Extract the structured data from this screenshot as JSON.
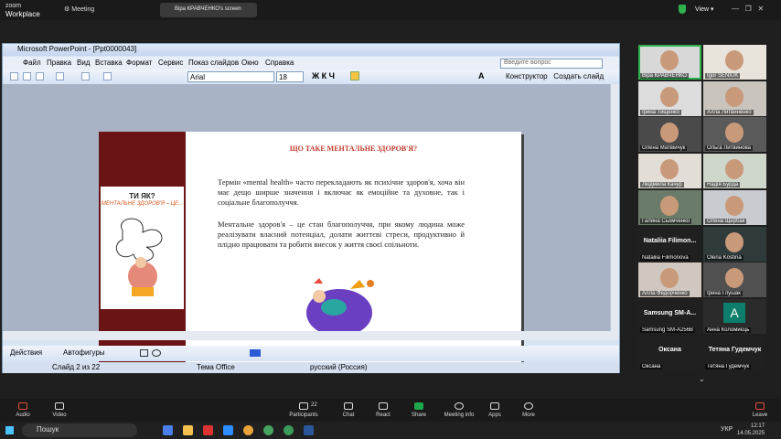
{
  "zoom": {
    "logo_top": "zoom",
    "logo_bottom": "Workplace",
    "meeting": "Meeting",
    "share_title": "Віра КРАВЧЕНКО's screen",
    "view": "View"
  },
  "ppt": {
    "title": "Microsoft PowerPoint - [Ppt0000043]",
    "menu": [
      "Файл",
      "Правка",
      "Вид",
      "Вставка",
      "Формат",
      "Сервис",
      "Показ слайдов",
      "Окно",
      "Справка"
    ],
    "question_placeholder": "Введите вопрос",
    "font": "Arial",
    "size": "18",
    "constructor": "Конструктор",
    "create_slide": "Создать слайд",
    "draw_actions": "Действия",
    "autoshapes": "Автофигуры",
    "status": {
      "slide": "Слайд 2 из 22",
      "theme": "Тема Office",
      "lang": "русский (Россия)"
    }
  },
  "slide": {
    "title": "ЩО ТАКЕ МЕНТАЛЬНЕ ЗДОРОВ'Я?",
    "p1": "Термін «mental health» часто перекладають як психічне здоров'я, хоча він має дещо ширше значення і включає як емоційне та духовне, так і соціальне благополуччя.",
    "p2": "Ментальне здоров'я – це стан благополуччя, при якому людина може реалізувати власний потенціал, долати життєві стреси, продуктивно й плідно працювати та робити внесок у життя своєї спільноти.",
    "cover_title": "ТИ ЯК?",
    "cover_sub": "МЕНТАЛЬНЕ ЗДОРОВ'Я – ЦЕ...",
    "number": "2"
  },
  "participants": [
    "Віра КРАВЧЕНКО",
    "Igor SENIUK",
    "Ірина Тищенко",
    "Алла Литвиненко",
    "Олена Матвійчук",
    "Ольга Литвинова",
    "Людмила Качур",
    "Надія Бурда",
    "Галина Сьомченко",
    "Олена Щербак",
    "Nataliia Filimonova",
    "Olena Kostina",
    "Алла Федорченко",
    "Ірина Глушак",
    "Samsung SM-A256B",
    "Анна Коломиєць",
    "Оксана",
    "Тетяна Гудемчук"
  ],
  "tiles_big": {
    "t10": "Nataliia Filimon...",
    "t14": "Samsung SM-A...",
    "t16": "Оксана",
    "t17": "Тетяна Гудемчук"
  },
  "avatar_letter": "A",
  "toolbar": {
    "audio": "Audio",
    "video": "Video",
    "participants": "Participants",
    "participants_count": "22",
    "chat": "Chat",
    "react": "React",
    "share": "Share",
    "info": "Meeting info",
    "apps": "Apps",
    "more": "More",
    "leave": "Leave"
  },
  "taskbar": {
    "search": "Пошук",
    "lang": "УКР",
    "time": "12:17",
    "date": "14.05.2025"
  }
}
